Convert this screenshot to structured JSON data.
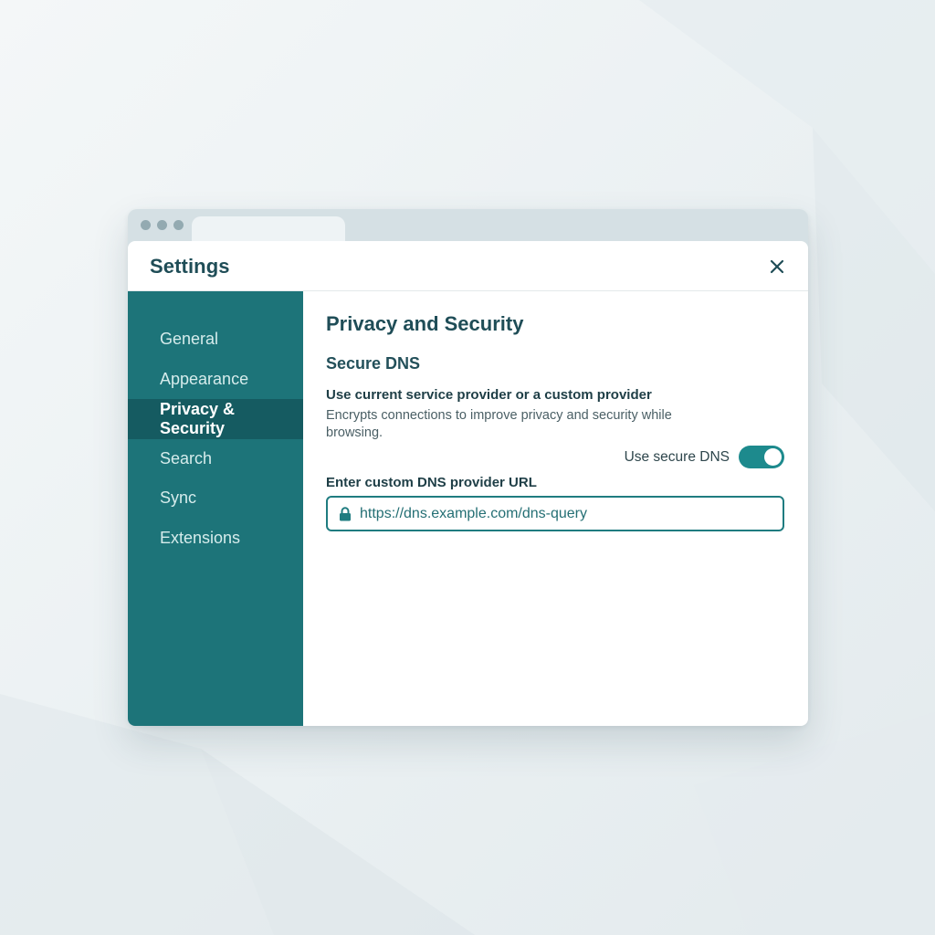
{
  "dialog": {
    "title": "Settings",
    "close_icon": "close-icon"
  },
  "sidebar": {
    "items": [
      {
        "label": "General",
        "active": false
      },
      {
        "label": "Appearance",
        "active": false
      },
      {
        "label": "Privacy & Security",
        "active": true
      },
      {
        "label": "Search",
        "active": false
      },
      {
        "label": "Sync",
        "active": false
      },
      {
        "label": "Extensions",
        "active": false
      }
    ]
  },
  "content": {
    "section_title": "Privacy and Security",
    "subsection_title": "Secure DNS",
    "option_label": "Use current service provider or a custom provider",
    "option_description": "Encrypts connections to improve privacy and security while browsing.",
    "toggle_label": "Use secure DNS",
    "toggle_on": true,
    "url_label": "Enter custom DNS provider URL",
    "url_value": "https://dns.example.com/dns-query",
    "url_icon": "lock-icon"
  },
  "colors": {
    "sidebar_bg": "#1d7479",
    "sidebar_active_bg": "#155b61",
    "accent": "#1d8a8d",
    "heading": "#1f4d57"
  }
}
